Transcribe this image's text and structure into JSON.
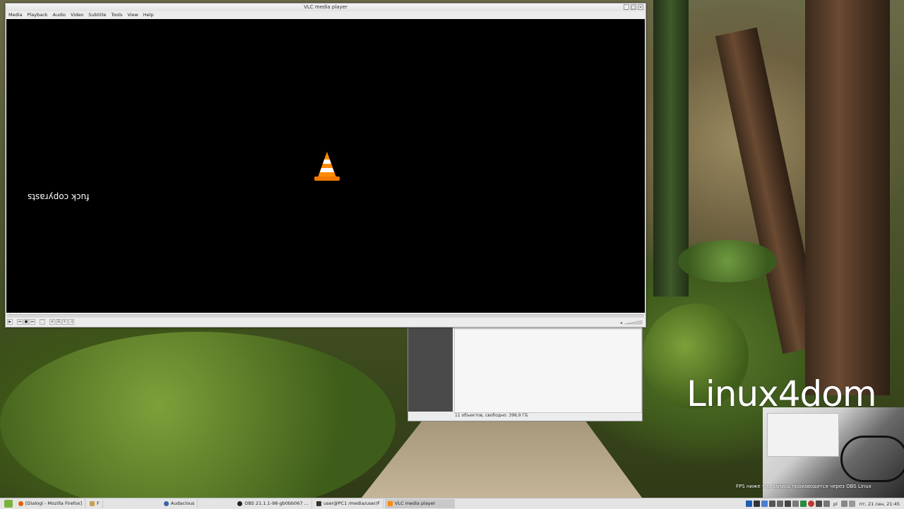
{
  "vlc": {
    "title": "VLC media player",
    "menu": [
      "Media",
      "Playback",
      "Audio",
      "Video",
      "Subtitle",
      "Tools",
      "View",
      "Help"
    ],
    "subtitle_text": "fuck copyrasts",
    "elapsed": "--:--",
    "remaining": "--:--",
    "window_buttons": [
      "_",
      "□",
      "✕"
    ]
  },
  "file_manager": {
    "status": "11 объектов, свободно: 396,9 ГБ"
  },
  "overlay": {
    "brand": "Linux4dom",
    "fps_note": "FPS ниже т.к. запись производится через OBS Linux"
  },
  "taskbar": {
    "tasks": [
      {
        "label": "[Dialogi - Mozilla Firefox]",
        "icon": "firefox-icon",
        "active": false
      },
      {
        "label": "F",
        "icon": "folder-icon",
        "active": false
      },
      {
        "label": "Audacious",
        "icon": "audacious-icon",
        "active": false
      },
      {
        "label": "OBS 21.1.1-98-gb0bb067 ...",
        "icon": "obs-icon",
        "active": false
      },
      {
        "label": "user@PC1 /media/user/F",
        "icon": "terminal-icon",
        "active": false
      },
      {
        "label": "VLC media player",
        "icon": "vlc-icon",
        "active": true
      }
    ],
    "keyboard_layout": "pl",
    "clock": "пт, 21 сен, 21:45"
  },
  "colors": {
    "vlc_orange": "#ff8c00",
    "video_bg": "#000000",
    "taskbar_bg": "#e4e4e4"
  }
}
